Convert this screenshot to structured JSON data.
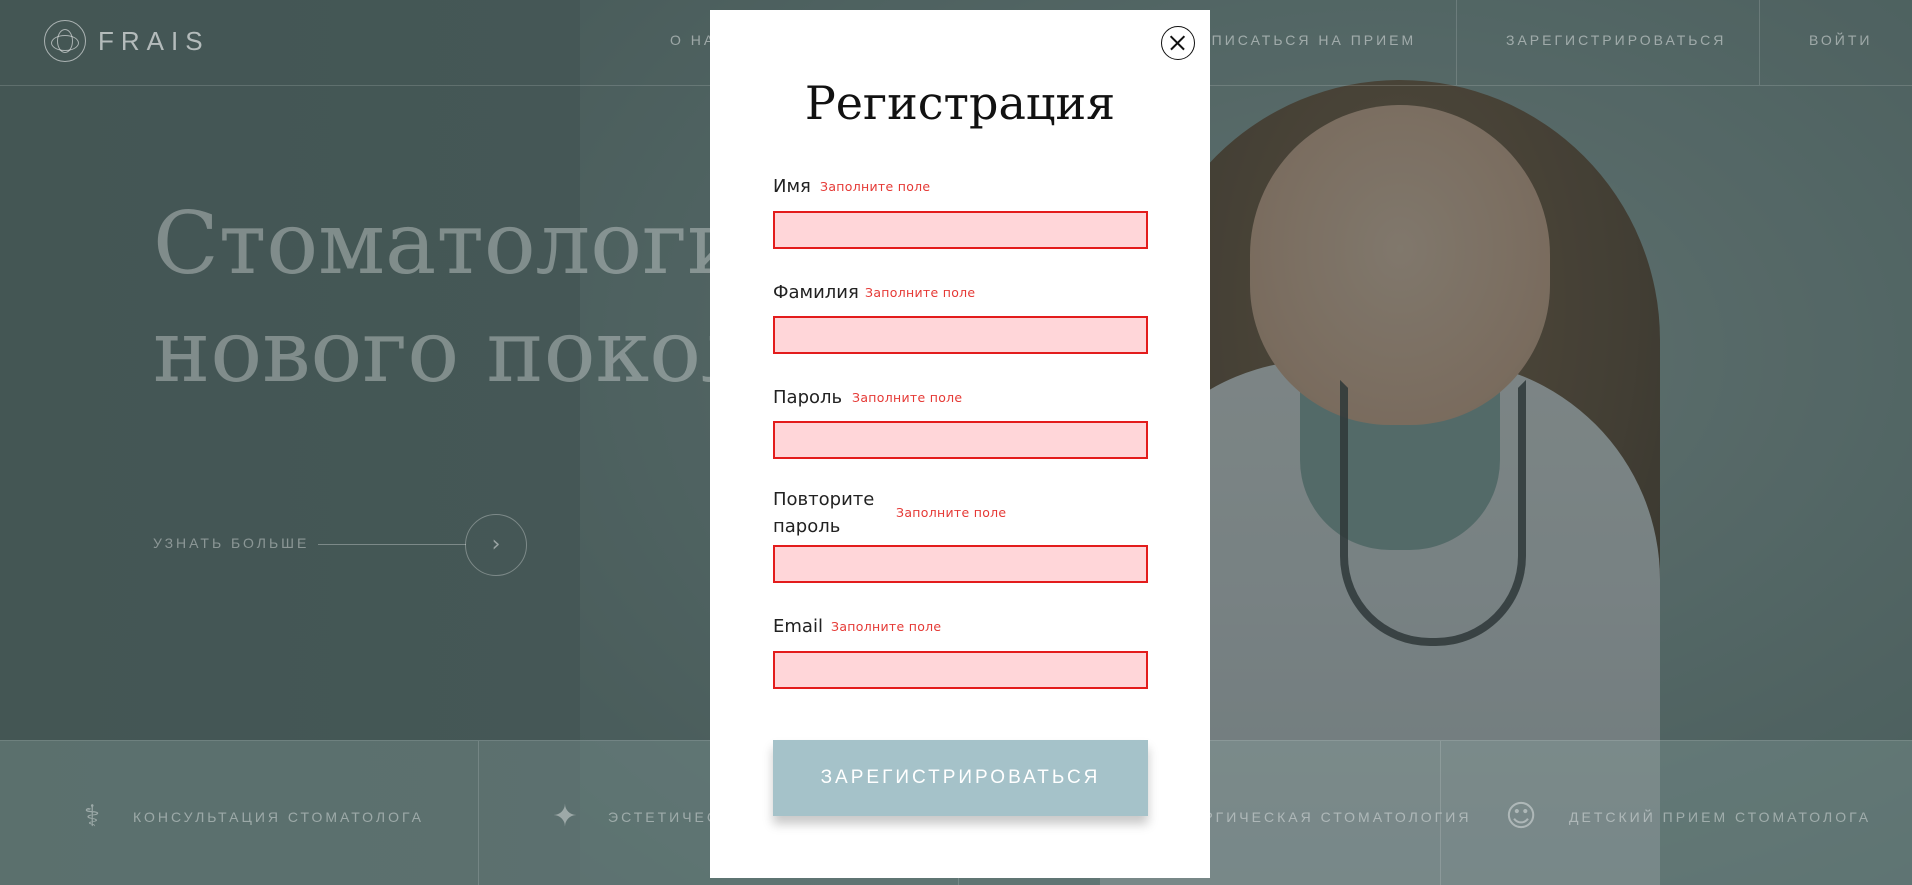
{
  "header": {
    "logo_text": "FRAIS",
    "nav": [
      "О НАС",
      "ЗАПИСАТЬСЯ НА ПРИЕМ",
      "ЗАРЕГИСТРИРОВАТЬСЯ",
      "ВОЙТИ"
    ]
  },
  "hero": {
    "title": "Стоматология\nнового поколения",
    "learn_more": "УЗНАТЬ БОЛЬШЕ"
  },
  "services": [
    {
      "label": "КОНСУЛЬТАЦИЯ СТОМАТОЛОГА",
      "icon": "doctor-icon"
    },
    {
      "label": "ЭСТЕТИЧЕСКАЯ СТОМАТОЛОГИЯ",
      "icon": "sparkle-tooth-icon"
    },
    {
      "label": "ХИРУРГИЧЕСКАЯ СТОМАТОЛОГИЯ",
      "icon": "tooth-icon"
    },
    {
      "label": "ДЕТСКИЙ ПРИЕМ СТОМАТОЛОГА",
      "icon": "baby-face-icon"
    }
  ],
  "modal": {
    "title": "Регистрация",
    "fields": [
      {
        "label": "Имя",
        "error": "Заполните поле",
        "value": ""
      },
      {
        "label": "Фамилия",
        "error": "Заполните поле",
        "value": ""
      },
      {
        "label": "Пароль",
        "error": "Заполните поле",
        "value": ""
      },
      {
        "label": "Повторите пароль",
        "error": "Заполните поле",
        "value": ""
      },
      {
        "label": "Email",
        "error": "Заполните поле",
        "value": ""
      }
    ],
    "submit_label": "ЗАРЕГИСТРИРОВАТЬСЯ"
  },
  "colors": {
    "error": "#e31c1c",
    "field_bg": "#ffd6d9",
    "button": "#a5c2c9",
    "overlay": "#23302e"
  }
}
